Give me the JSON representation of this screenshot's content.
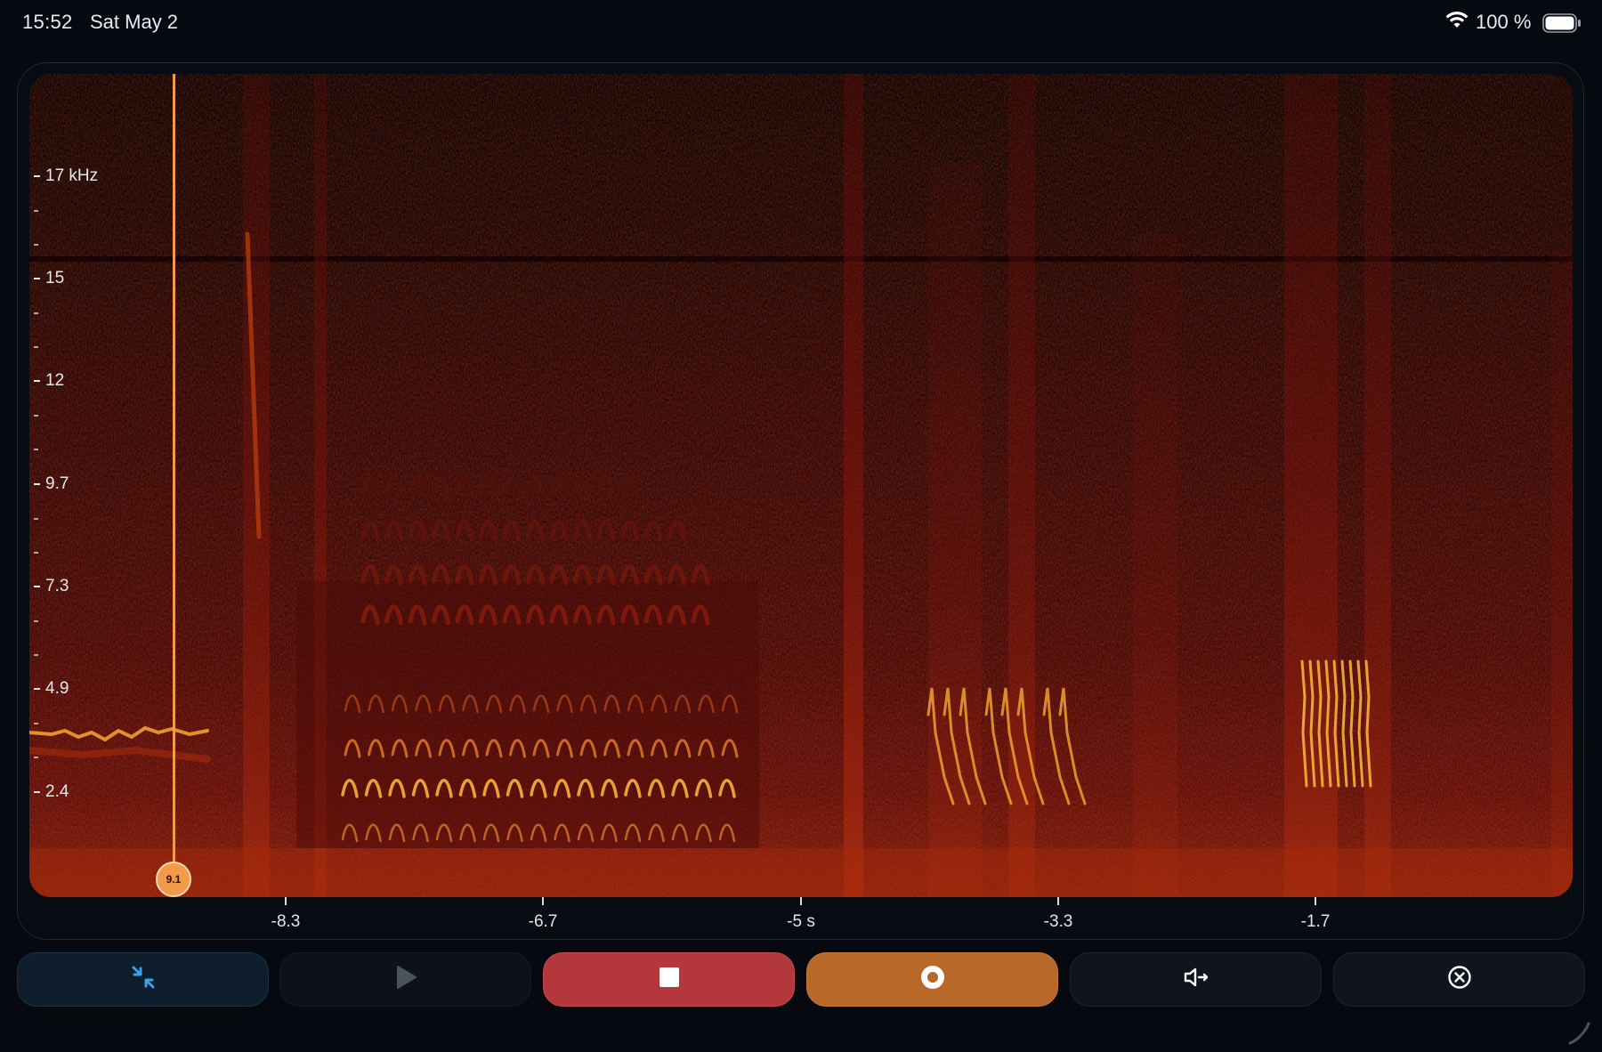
{
  "status": {
    "time": "15:52",
    "date": "Sat May 2",
    "battery": "100 %",
    "wifi_icon": "wifi-icon",
    "battery_icon": "battery-icon"
  },
  "spectrogram": {
    "y_axis": {
      "labels": [
        "17 kHz",
        "15",
        "12",
        "9.7",
        "7.3",
        "4.9",
        "2.4"
      ]
    },
    "x_axis": {
      "labels": [
        "-8.3",
        "-6.7",
        "-5 s",
        "-3.3",
        "-1.7"
      ]
    },
    "cursor": {
      "value": "9.1"
    }
  },
  "toolbar": {
    "buttons": [
      {
        "name": "collapse-button",
        "icon": "collapse-arrows-icon",
        "color": "#3aa0f0"
      },
      {
        "name": "play-button",
        "icon": "play-icon",
        "color": "#4a525d"
      },
      {
        "name": "stop-button",
        "icon": "stop-icon",
        "color": "#ffffff"
      },
      {
        "name": "record-button",
        "icon": "record-icon",
        "color": "#ffffff"
      },
      {
        "name": "speaker-button",
        "icon": "speaker-output-icon",
        "color": "#ffffff"
      },
      {
        "name": "close-button",
        "icon": "close-circle-icon",
        "color": "#ffffff"
      }
    ]
  },
  "colors": {
    "accent_orange": "#f39a4a",
    "stop_red": "#b3373b",
    "record_orange": "#b8692a",
    "background": "#06090f"
  }
}
